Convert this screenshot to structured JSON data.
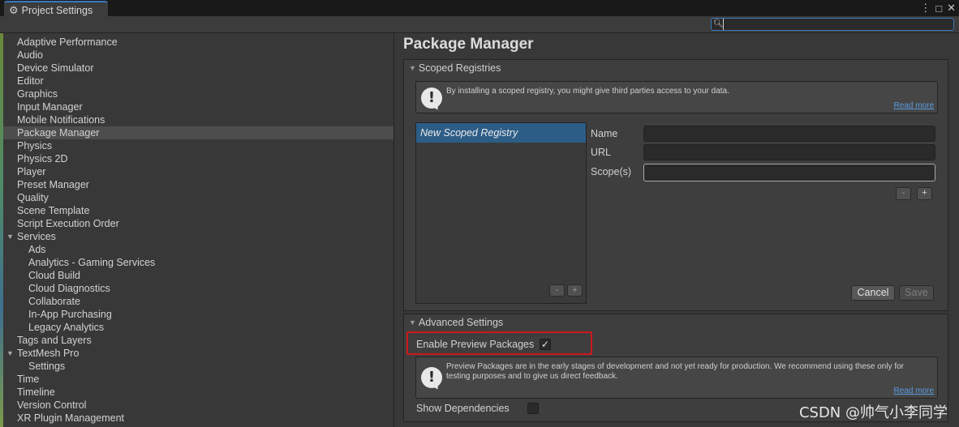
{
  "window": {
    "tab_title": "Project Settings",
    "tab_icon": "gear-icon",
    "menu_glyph": "⋮",
    "maximize_glyph": "□",
    "close_glyph": "✕"
  },
  "search": {
    "value": "",
    "placeholder": ""
  },
  "sidebar": {
    "items": [
      {
        "label": "Adaptive Performance",
        "level": 0
      },
      {
        "label": "Audio",
        "level": 0
      },
      {
        "label": "Device Simulator",
        "level": 0
      },
      {
        "label": "Editor",
        "level": 0
      },
      {
        "label": "Graphics",
        "level": 0
      },
      {
        "label": "Input Manager",
        "level": 0
      },
      {
        "label": "Mobile Notifications",
        "level": 0
      },
      {
        "label": "Package Manager",
        "level": 0,
        "selected": true
      },
      {
        "label": "Physics",
        "level": 0
      },
      {
        "label": "Physics 2D",
        "level": 0
      },
      {
        "label": "Player",
        "level": 0
      },
      {
        "label": "Preset Manager",
        "level": 0
      },
      {
        "label": "Quality",
        "level": 0
      },
      {
        "label": "Scene Template",
        "level": 0
      },
      {
        "label": "Script Execution Order",
        "level": 0
      },
      {
        "label": "Services",
        "level": 0,
        "expanded": true
      },
      {
        "label": "Ads",
        "level": 1
      },
      {
        "label": "Analytics - Gaming Services",
        "level": 1
      },
      {
        "label": "Cloud Build",
        "level": 1
      },
      {
        "label": "Cloud Diagnostics",
        "level": 1
      },
      {
        "label": "Collaborate",
        "level": 1
      },
      {
        "label": "In-App Purchasing",
        "level": 1
      },
      {
        "label": "Legacy Analytics",
        "level": 1
      },
      {
        "label": "Tags and Layers",
        "level": 0
      },
      {
        "label": "TextMesh Pro",
        "level": 0,
        "expanded": true
      },
      {
        "label": "Settings",
        "level": 1
      },
      {
        "label": "Time",
        "level": 0
      },
      {
        "label": "Timeline",
        "level": 0
      },
      {
        "label": "Version Control",
        "level": 0
      },
      {
        "label": "XR Plugin Management",
        "level": 0
      }
    ]
  },
  "main": {
    "title": "Package Manager",
    "scoped": {
      "header": "Scoped Registries",
      "help_text": "By installing a scoped registry, you might give third parties access to your data.",
      "help_link": "Read more",
      "registry_item": "New Scoped Registry",
      "list_minus": "-",
      "list_plus": "+",
      "name_label": "Name",
      "url_label": "URL",
      "scopes_label": "Scope(s)",
      "name_value": "",
      "url_value": "",
      "scopes_value": "",
      "scope_minus": "-",
      "scope_plus": "+",
      "cancel_label": "Cancel",
      "save_label": "Save"
    },
    "advanced": {
      "header": "Advanced Settings",
      "enable_preview_label": "Enable Preview Packages",
      "enable_preview_checked": true,
      "help_text": "Preview Packages are in the early stages of development and not yet ready for production. We recommend using these only for testing purposes and to give us direct feedback.",
      "help_link": "Read more",
      "show_deps_label": "Show Dependencies",
      "show_deps_checked": false
    }
  },
  "watermark": "CSDN @帅气小李同学",
  "colors": {
    "accent": "#3a79bb",
    "selection": "#2c5d87",
    "highlight_border": "#d0161d",
    "link": "#5a9be0"
  }
}
